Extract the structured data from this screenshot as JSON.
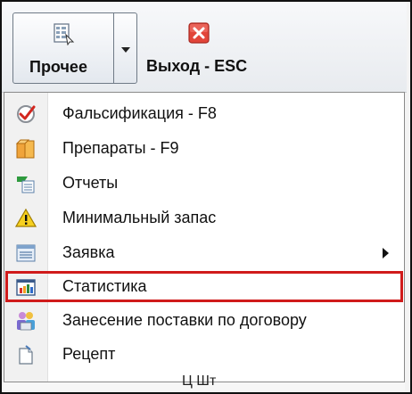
{
  "toolbar": {
    "other_button": {
      "label": "Прочее",
      "icon": "grid-report-icon"
    },
    "exit_button": {
      "label": "Выход - ESC",
      "icon": "close-red-icon"
    }
  },
  "menu": {
    "items": [
      {
        "label": "Фальсификация - F8",
        "icon": "checkmark-seal-icon"
      },
      {
        "label": "Препараты - F9",
        "icon": "boxes-icon"
      },
      {
        "label": "Отчеты",
        "icon": "report-table-icon"
      },
      {
        "label": "Минимальный запас",
        "icon": "warning-triangle-icon"
      },
      {
        "label": "Заявка",
        "icon": "list-form-icon",
        "has_submenu": true
      },
      {
        "label": "Статистика",
        "icon": "bar-chart-icon",
        "selected": true
      },
      {
        "label": "Занесение поставки по договору",
        "icon": "delivery-people-icon"
      },
      {
        "label": "Рецепт",
        "icon": "document-icon"
      }
    ]
  },
  "background_text": "Ц  Шт"
}
